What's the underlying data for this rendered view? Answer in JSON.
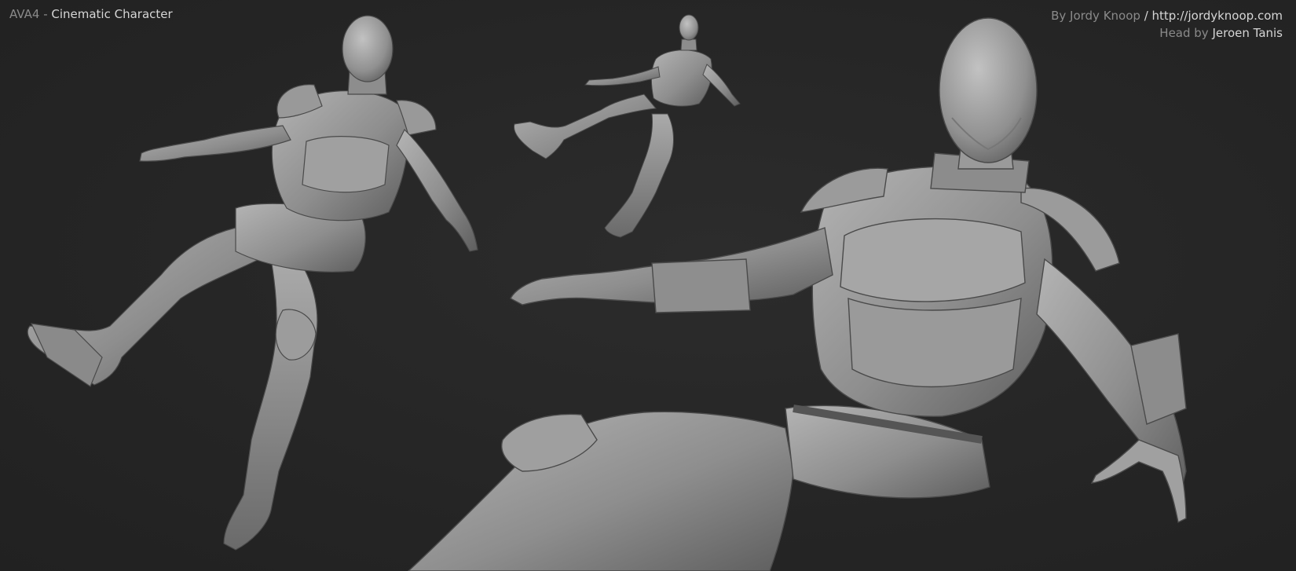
{
  "title": {
    "prefix": "AVA4",
    "separator": " - ",
    "name": "Cinematic Character"
  },
  "credits": {
    "by_label": "By Jordy Knoop",
    "slash": " / ",
    "url": "http://jordyknoop.com",
    "head_label": "Head by",
    "head_artist": "Jeroen Tanis"
  },
  "figures": [
    {
      "name": "figure-left",
      "description_icon": "armored-character-sculpt"
    },
    {
      "name": "figure-small-top",
      "description_icon": "armored-character-sculpt"
    },
    {
      "name": "figure-closeup-right",
      "description_icon": "armored-character-sculpt"
    }
  ],
  "colors": {
    "background": "#262626",
    "clay_light": "#a9a9a9",
    "clay_mid": "#8c8c8c",
    "clay_dark": "#5a5a5a",
    "text_dim": "#8a8a8a",
    "text_bright": "#d6d6d6"
  }
}
